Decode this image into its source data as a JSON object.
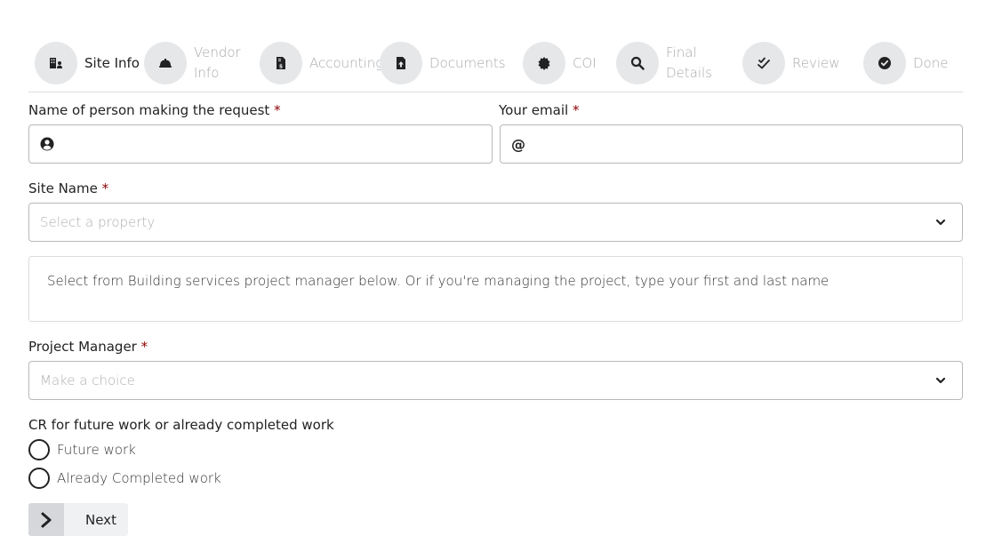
{
  "steps": [
    {
      "label": "Site Info",
      "icon": "building-user-icon",
      "active": true
    },
    {
      "label": "Vendor Info",
      "icon": "hard-hat-icon",
      "active": false
    },
    {
      "label": "Accounting",
      "icon": "invoice-dollar-icon",
      "active": false
    },
    {
      "label": "Documents",
      "icon": "file-upload-icon",
      "active": false
    },
    {
      "label": "COI",
      "icon": "certificate-icon",
      "active": false
    },
    {
      "label": "Final Details",
      "icon": "search-icon",
      "active": false
    },
    {
      "label": "Review",
      "icon": "double-check-icon",
      "active": false
    },
    {
      "label": "Done",
      "icon": "check-circle-icon",
      "active": false
    }
  ],
  "form": {
    "requester": {
      "label": "Name of person making the request",
      "required_mark": "*",
      "value": "",
      "icon": "user-circle-icon"
    },
    "email": {
      "label": "Your email",
      "required_mark": "*",
      "value": "",
      "icon": "at-icon",
      "icon_glyph": "@"
    },
    "site_name": {
      "label": "Site Name",
      "required_mark": "*",
      "placeholder": "Select a property"
    },
    "info_text": "Select from Building services project manager below. Or if you're managing the project, type your first and last name",
    "project_manager": {
      "label": "Project Manager",
      "required_mark": "*",
      "placeholder": "Make a choice"
    },
    "work_type": {
      "label": "CR for future work or already completed work",
      "options": [
        "Future work",
        "Already Completed work"
      ]
    }
  },
  "next_button": {
    "label": "Next"
  },
  "colors": {
    "required": "#8b0000",
    "step_circle": "#e6e7e9",
    "inactive_text": "#a9a9a9"
  }
}
